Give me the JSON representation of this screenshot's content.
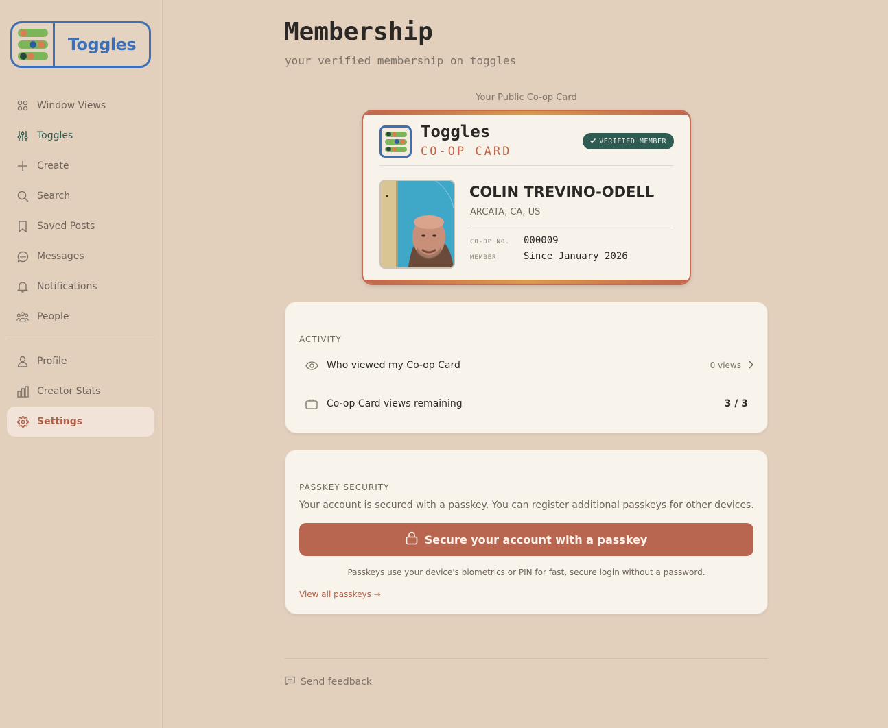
{
  "sidebar": {
    "logo_text": "Toggles",
    "items": [
      {
        "label": "Window Views",
        "icon": "grid-icon"
      },
      {
        "label": "Toggles",
        "icon": "sliders-icon"
      },
      {
        "label": "Create",
        "icon": "plus-icon"
      },
      {
        "label": "Search",
        "icon": "search-icon"
      },
      {
        "label": "Saved Posts",
        "icon": "bookmark-icon"
      },
      {
        "label": "Messages",
        "icon": "chat-bubble-icon"
      },
      {
        "label": "Notifications",
        "icon": "bell-icon"
      },
      {
        "label": "People",
        "icon": "people-icon"
      }
    ],
    "secondary_items": [
      {
        "label": "Profile",
        "icon": "user-icon"
      },
      {
        "label": "Creator Stats",
        "icon": "bar-chart-icon"
      },
      {
        "label": "Settings",
        "icon": "gear-icon",
        "active": true
      }
    ]
  },
  "page": {
    "title": "Membership",
    "subtitle": "your verified membership on toggles"
  },
  "coop_card": {
    "caption": "Your Public Co-op Card",
    "brand": "Toggles",
    "brand_sub": "CO-OP CARD",
    "verified_badge": "VERIFIED MEMBER",
    "name": "COLIN TREVINO-ODELL",
    "location": "ARCATA, CA, US",
    "coop_no_label": "CO-OP NO.",
    "coop_no_value": "000009",
    "member_label": "MEMBER",
    "member_value": "Since January 2026"
  },
  "activity": {
    "heading": "ACTIVITY",
    "viewed_label": "Who viewed my Co-op Card",
    "viewed_meta": "0 views",
    "remaining_label": "Co-op Card views remaining",
    "remaining_value": "3 / 3"
  },
  "passkey": {
    "heading": "PASSKEY SECURITY",
    "description": "Your account is secured with a passkey. You can register additional passkeys for other devices.",
    "button_label": "Secure your account with a passkey",
    "note": "Passkeys use your device's biometrics or PIN for fast, secure login without a password.",
    "link": "View all passkeys →"
  },
  "footer": {
    "feedback": "Send feedback"
  },
  "colors": {
    "background": "#e2cfbc",
    "accent": "#b86650",
    "brand_blue": "#3c6fb5",
    "verified_green": "#2e5b52"
  }
}
